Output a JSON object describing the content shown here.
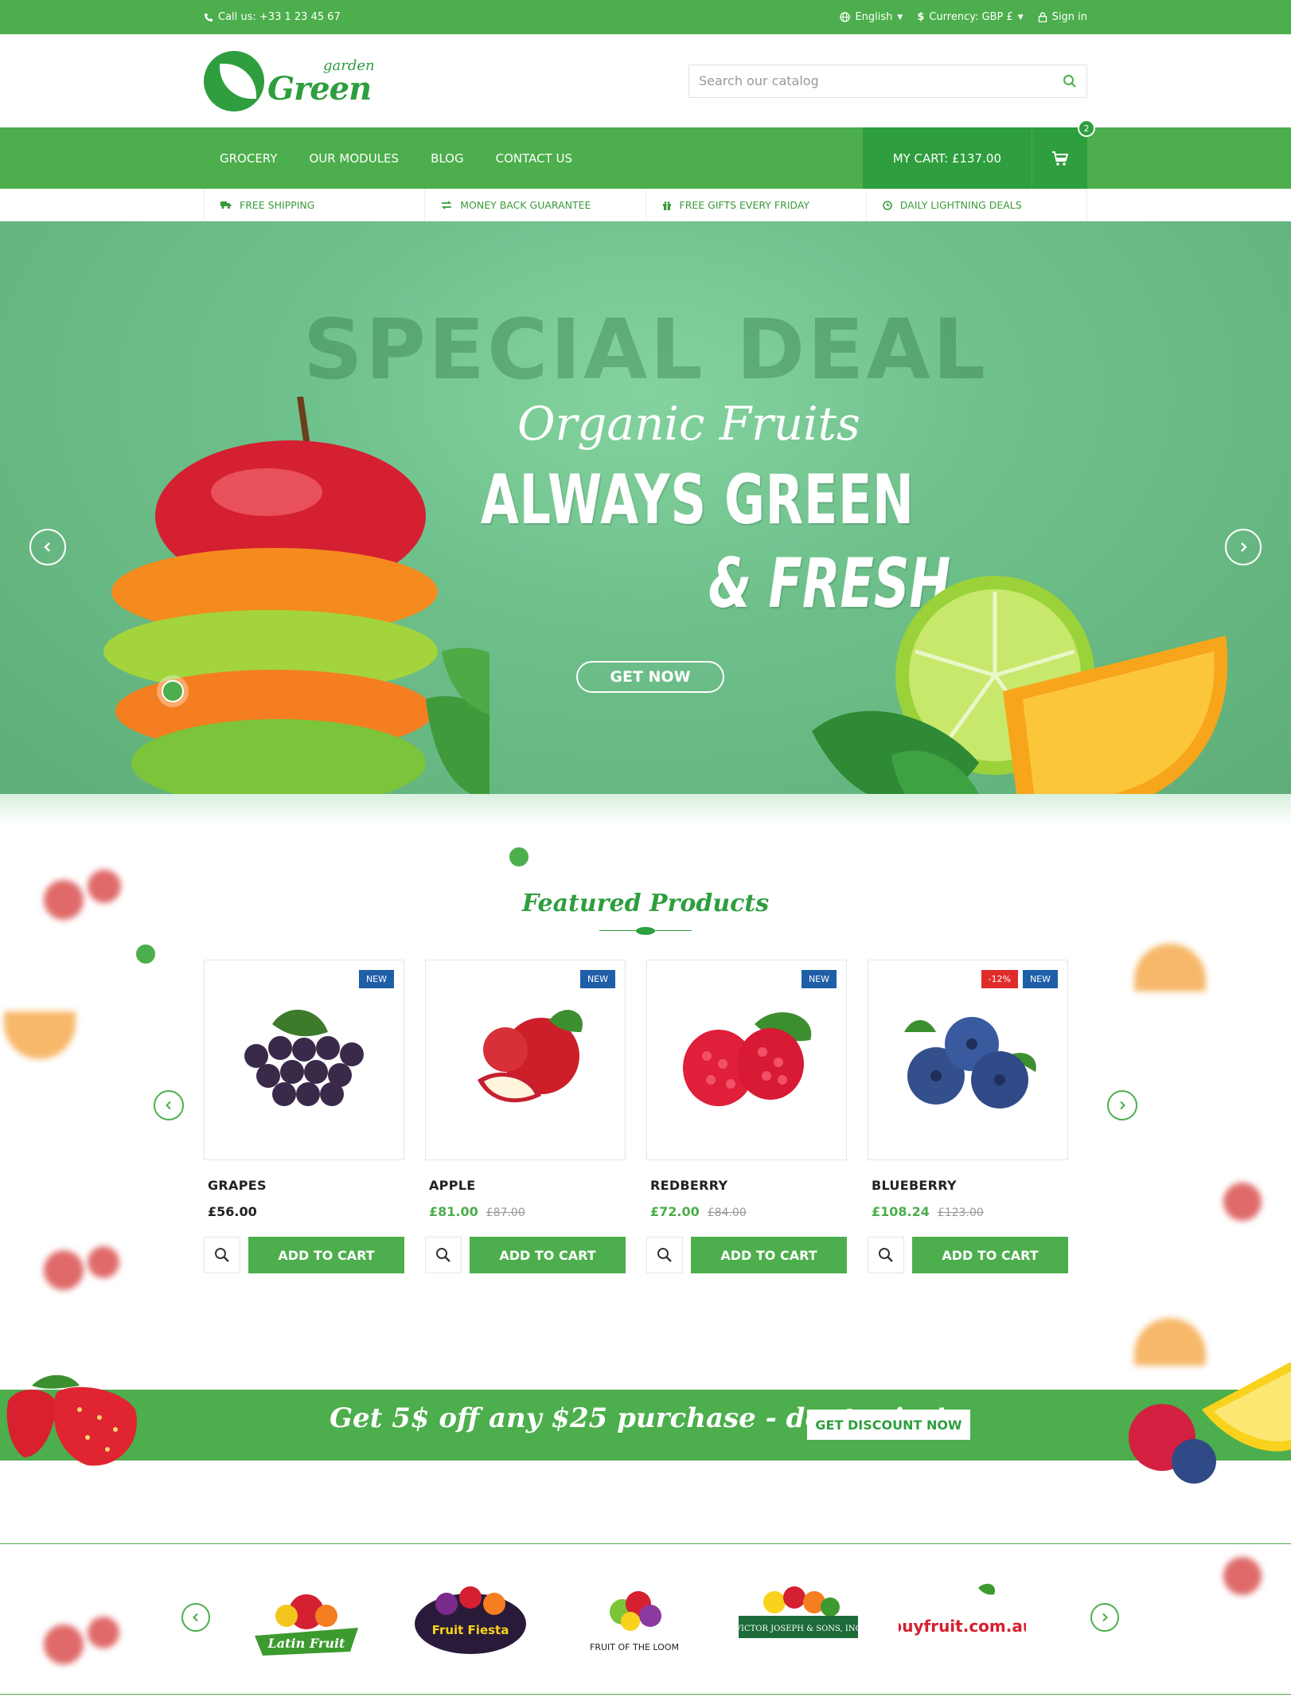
{
  "topbar": {
    "phone": "Call us: +33 1 23 45 67",
    "language": "English",
    "currency": "Currency: GBP £",
    "signin": "Sign in"
  },
  "header": {
    "logo_small": "garden",
    "logo_big": "Green",
    "search_placeholder": "Search our catalog"
  },
  "nav": {
    "items": [
      "GROCERY",
      "OUR MODULES",
      "BLOG",
      "CONTACT US"
    ],
    "cart_label": "MY CART: £137.00",
    "cart_count": "2"
  },
  "features": [
    "FREE SHIPPING",
    "MONEY BACK GUARANTEE",
    "FREE GIFTS EVERY FRIDAY",
    "DAILY LIGHTNING DEALS"
  ],
  "hero": {
    "deal": "SPECIAL DEAL",
    "script": "Organic Fruits",
    "line1": "ALWAYS GREEN",
    "line2": "& FRESH",
    "button": "GET NOW"
  },
  "featured": {
    "title": "Featured Products",
    "products": [
      {
        "name": "GRAPES",
        "price": "£56.00",
        "old_price": "",
        "badges": [
          "NEW"
        ],
        "add": "ADD TO CART"
      },
      {
        "name": "APPLE",
        "price": "£81.00",
        "old_price": "£87.00",
        "badges": [
          "NEW"
        ],
        "add": "ADD TO CART"
      },
      {
        "name": "REDBERRY",
        "price": "£72.00",
        "old_price": "£84.00",
        "badges": [
          "NEW"
        ],
        "add": "ADD TO CART"
      },
      {
        "name": "BLUEBERRY",
        "price": "£108.24",
        "old_price": "£123.00",
        "badges": [
          "-12%",
          "NEW"
        ],
        "add": "ADD TO CART"
      }
    ]
  },
  "promo": {
    "text": "Get 5$ off any $25 purchase - dont miss!",
    "button": "GET DISCOUNT NOW"
  },
  "brands": [
    "Latin Fruit",
    "Fruit Fiesta",
    "FRUIT OF THE LOOM",
    "VICTOR JOSEPH & SONS, INC",
    "buyfruit.com.au"
  ],
  "colors": {
    "green": "#4cae4c",
    "dark_green": "#2e9e3e",
    "blue_badge": "#1f5fa8",
    "red_badge": "#e02b2b"
  }
}
